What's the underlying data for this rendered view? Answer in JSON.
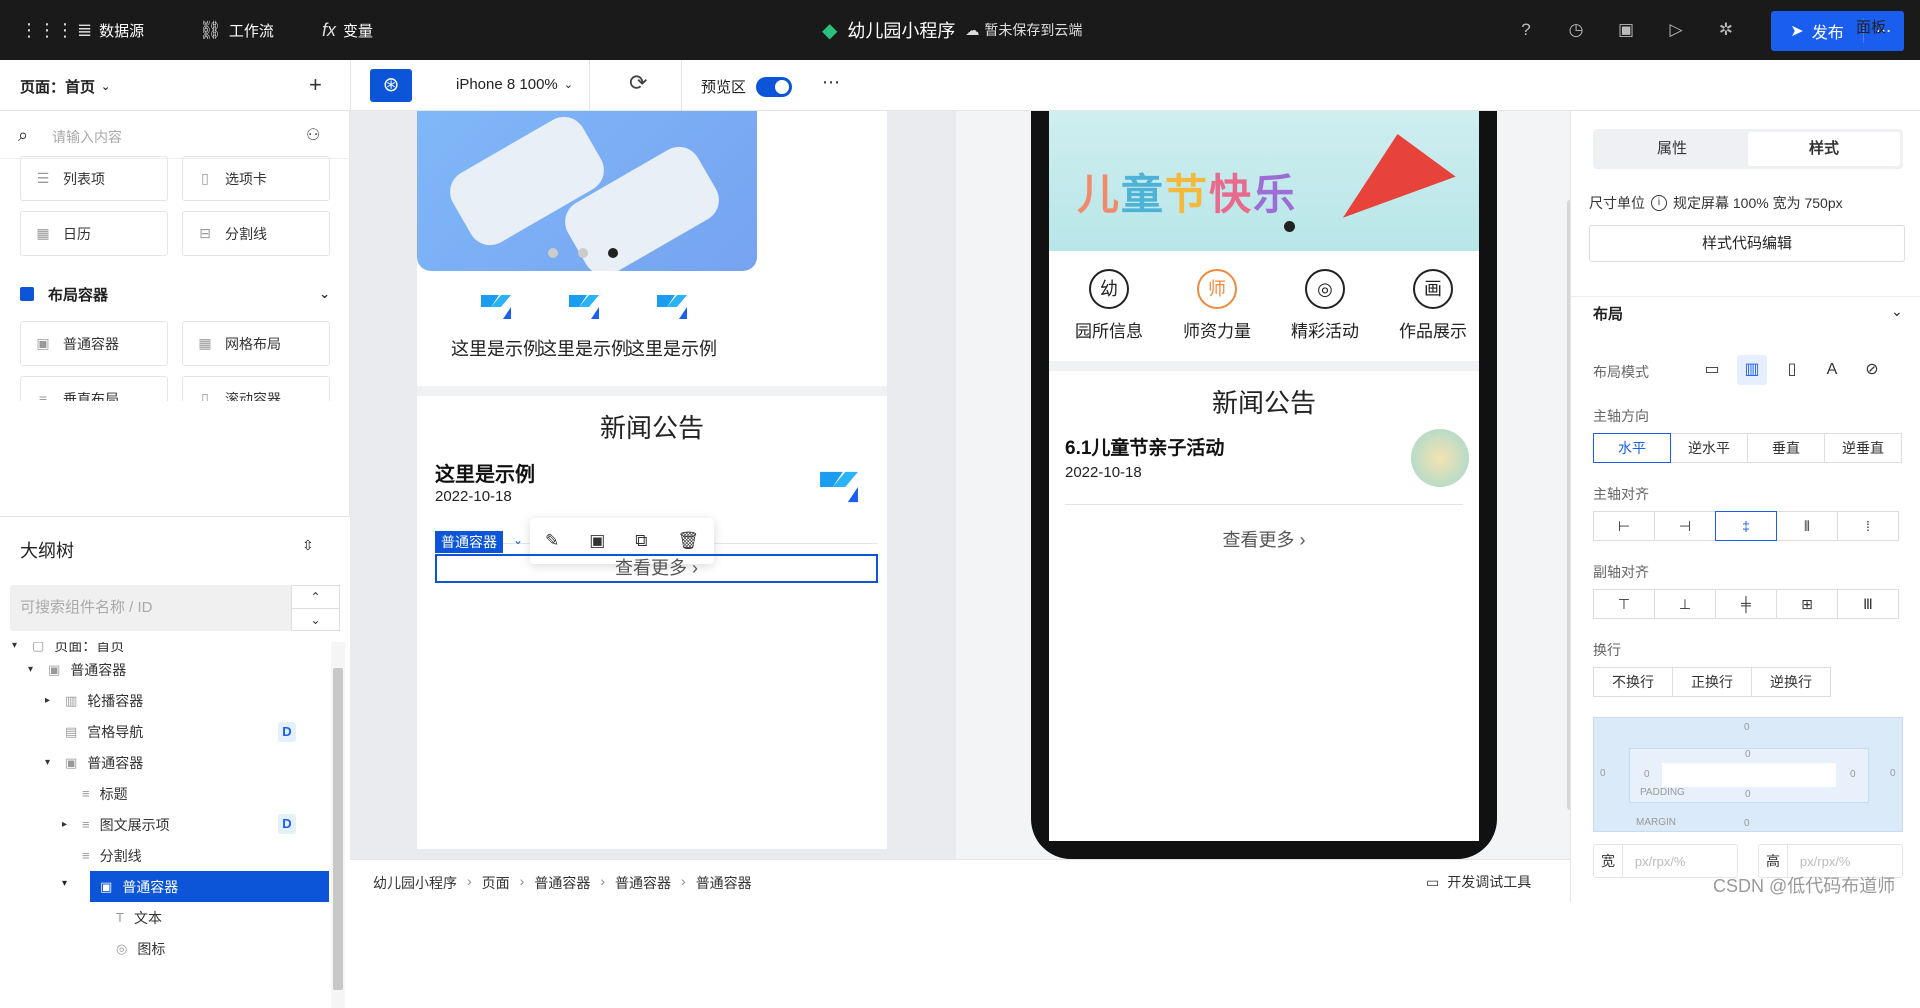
{
  "topbar": {
    "datasource": "数据源",
    "workflow": "工作流",
    "variables": "变量",
    "app_title": "幼儿园小程序",
    "save_status": "暂未保存到云端",
    "publish": "发布"
  },
  "toolbar": {
    "page_selector": "页面：首页",
    "device": "iPhone 8 100%",
    "preview_label": "预览区",
    "panel": "面板"
  },
  "left": {
    "search_placeholder": "请输入内容",
    "components": [
      {
        "label": "列表项"
      },
      {
        "label": "选项卡"
      },
      {
        "label": "日历"
      },
      {
        "label": "分割线"
      }
    ],
    "group_title": "布局容器",
    "layout_components": [
      {
        "label": "普通容器"
      },
      {
        "label": "网格布局"
      },
      {
        "label": "垂直布局"
      },
      {
        "label": "滚动容器"
      }
    ],
    "outline_title": "大纲树",
    "outline_search_placeholder": "可搜索组件名称 / ID",
    "tree": [
      {
        "label": "页面：首页"
      },
      {
        "label": "普通容器"
      },
      {
        "label": "轮播容器"
      },
      {
        "label": "宫格导航",
        "badge": "D"
      },
      {
        "label": "普通容器"
      },
      {
        "label": "标题"
      },
      {
        "label": "图文展示项",
        "badge": "D"
      },
      {
        "label": "分割线"
      },
      {
        "label": "普通容器"
      },
      {
        "label": "文本"
      },
      {
        "label": "图标"
      }
    ]
  },
  "canvas_left": {
    "grid_items": [
      "这里是示例",
      "这里是示例",
      "这里是示例"
    ],
    "news_title": "新闻公告",
    "news_heading": "这里是示例",
    "news_date": "2022-10-18",
    "selected_tag": "普通容器",
    "more": "查看更多"
  },
  "phone": {
    "banner_text": [
      "儿",
      "童",
      "节",
      "快",
      "乐"
    ],
    "grid_items": [
      {
        "label": "园所信息",
        "icon": "幼"
      },
      {
        "label": "师资力量",
        "icon": "师"
      },
      {
        "label": "精彩活动",
        "icon": "◎"
      },
      {
        "label": "作品展示",
        "icon": "画"
      }
    ],
    "news_title": "新闻公告",
    "news_heading": "6.1儿童节亲子活动",
    "news_date": "2022-10-18",
    "more": "查看更多"
  },
  "breadcrumbs": [
    "幼儿园小程序",
    "页面",
    "普通容器",
    "普通容器",
    "普通容器"
  ],
  "devtools": "开发调试工具",
  "right": {
    "tab_props": "属性",
    "tab_style": "样式",
    "unit_label": "尺寸单位",
    "unit_value": "规定屏幕 100% 宽为 750px",
    "style_code": "样式代码编辑",
    "layout_section": "布局",
    "layout_mode": "布局模式",
    "main_axis_dir": "主轴方向",
    "main_axis_dir_options": [
      "水平",
      "逆水平",
      "垂直",
      "逆垂直"
    ],
    "main_axis_align": "主轴对齐",
    "cross_axis_align": "副轴对齐",
    "wrap": "换行",
    "wrap_options": [
      "不换行",
      "正换行",
      "逆换行"
    ],
    "box": {
      "padding": "PADDING",
      "margin": "MARGIN",
      "zero": "0"
    },
    "width_label": "宽",
    "height_label": "高",
    "size_placeholder": "px/rpx/%"
  },
  "watermark": "CSDN @低代码布道师"
}
